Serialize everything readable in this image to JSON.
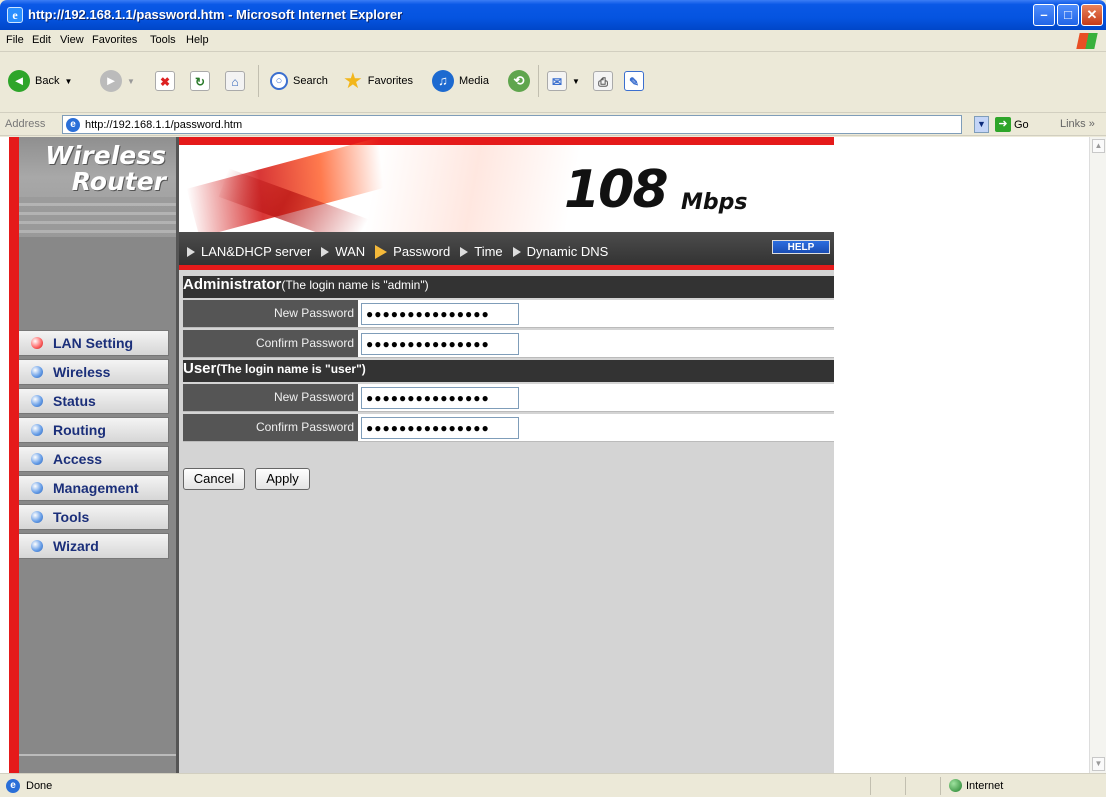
{
  "window": {
    "title": "http://192.168.1.1/password.htm - Microsoft Internet Explorer"
  },
  "menu": [
    "File",
    "Edit",
    "View",
    "Favorites",
    "Tools",
    "Help"
  ],
  "toolbar": {
    "back": "Back",
    "search": "Search",
    "favorites": "Favorites",
    "media": "Media"
  },
  "address": {
    "label": "Address",
    "url": "http://192.168.1.1/password.htm",
    "go": "Go",
    "links": "Links"
  },
  "brand": {
    "line1": "Wireless",
    "line2": "Router",
    "speed": "108",
    "unit": "Mbps"
  },
  "sidebar": {
    "items": [
      {
        "label": "LAN Setting",
        "active": true
      },
      {
        "label": "Wireless"
      },
      {
        "label": "Status"
      },
      {
        "label": "Routing"
      },
      {
        "label": "Access"
      },
      {
        "label": "Management"
      },
      {
        "label": "Tools"
      },
      {
        "label": "Wizard"
      }
    ]
  },
  "tabs": [
    "LAN&DHCP server",
    "WAN",
    "Password",
    "Time",
    "Dynamic DNS"
  ],
  "help": "HELP",
  "admin": {
    "title": "Administrator",
    "note": "(The login name is \"admin\")",
    "new_label": "New Password",
    "new_value": "●●●●●●●●●●●●●●●",
    "confirm_label": "Confirm Password",
    "confirm_value": "●●●●●●●●●●●●●●●"
  },
  "user": {
    "title": "User",
    "note": "(The login name is \"user\")",
    "new_label": "New Password",
    "new_value": "●●●●●●●●●●●●●●●",
    "confirm_label": "Confirm Password",
    "confirm_value": "●●●●●●●●●●●●●●●"
  },
  "buttons": {
    "cancel": "Cancel",
    "apply": "Apply"
  },
  "status": {
    "text": "Done",
    "zone": "Internet"
  }
}
